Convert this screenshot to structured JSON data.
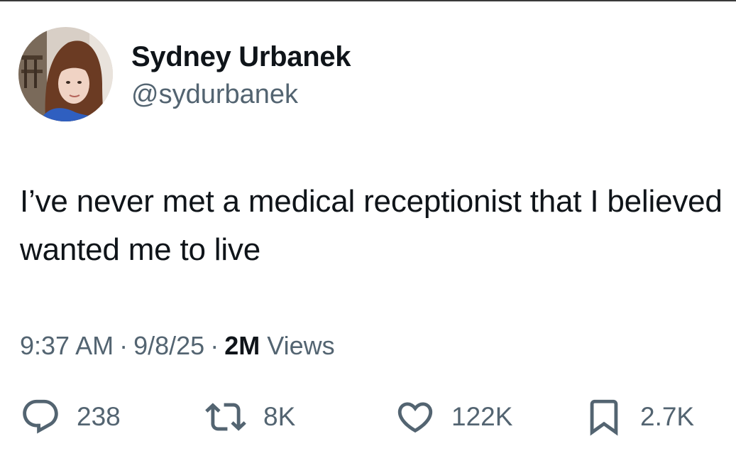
{
  "author": {
    "display_name": "Sydney Urbanek",
    "handle": "@sydurbanek"
  },
  "tweet": {
    "text": "I’ve never met a medical receptionist that I believed wanted me to live"
  },
  "meta": {
    "time": "9:37 AM",
    "date": "9/8/25",
    "separator": "·",
    "views_count": "2M",
    "views_label": "Views"
  },
  "actions": {
    "replies": "238",
    "reposts": "8K",
    "likes": "122K",
    "bookmarks": "2.7K"
  },
  "colors": {
    "primary_text": "#0f1419",
    "secondary_text": "#536471",
    "icon": "#536471"
  },
  "icons": [
    "reply-icon",
    "retweet-icon",
    "heart-icon",
    "bookmark-icon"
  ]
}
